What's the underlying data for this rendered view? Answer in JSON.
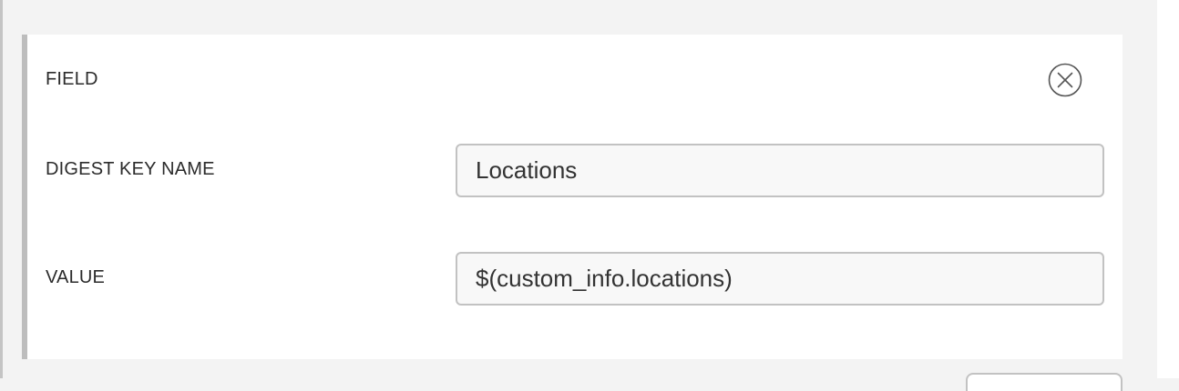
{
  "form": {
    "field_label": "FIELD",
    "digest_key_label": "DIGEST KEY NAME",
    "digest_key_value": "Locations",
    "value_label": "VALUE",
    "value_value": "$(custom_info.locations)"
  },
  "icons": {
    "remove": "close-circle-icon"
  },
  "colors": {
    "page_background": "#f3f3f3",
    "card_background": "#ffffff",
    "card_accent_border": "#bdbdbd",
    "input_border": "#c2c2c2",
    "input_background": "#f8f8f8",
    "text": "#2b2b2b"
  }
}
